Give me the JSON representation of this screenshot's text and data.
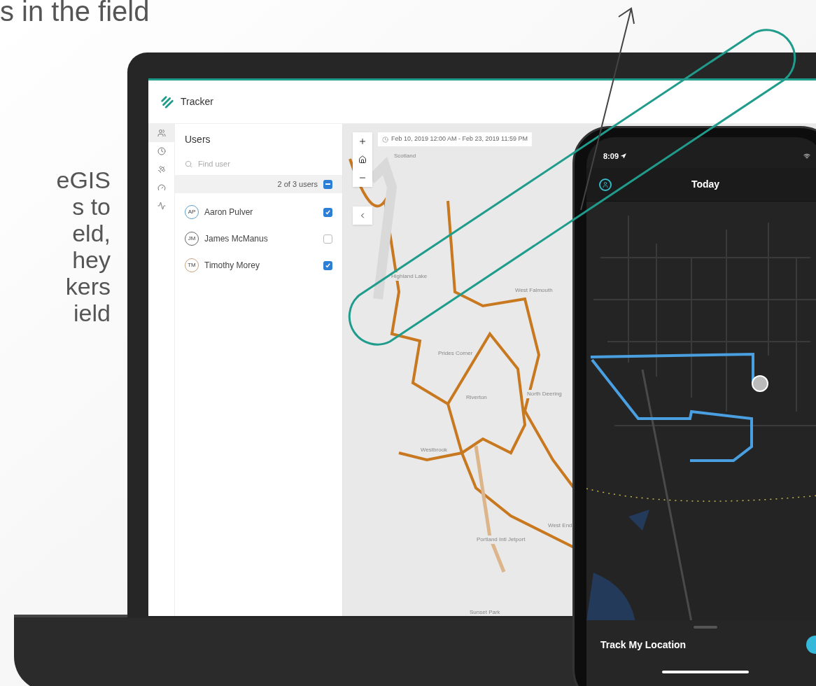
{
  "slide": {
    "heading": "s in the field",
    "body_lines": [
      "eGIS",
      "s to",
      "eld,",
      "hey",
      "kers",
      "ield"
    ]
  },
  "tracker": {
    "app_title": "Tracker",
    "rail": [
      {
        "kind": "users",
        "selected": true
      },
      {
        "kind": "time",
        "selected": false
      },
      {
        "kind": "satellite",
        "selected": false
      },
      {
        "kind": "gauge",
        "selected": false
      },
      {
        "kind": "pulse",
        "selected": false
      }
    ],
    "users_panel": {
      "title": "Users",
      "search": {
        "placeholder": "Find user"
      },
      "count": "2 of 3 users",
      "select_all_partial": true,
      "users": [
        {
          "initials": "AP",
          "name": "Aaron Pulver",
          "checked": true,
          "color": "#5a9ec9"
        },
        {
          "initials": "JM",
          "name": "James McManus",
          "checked": false,
          "color": "#666666"
        },
        {
          "initials": "TM",
          "name": "Timothy Morey",
          "checked": true,
          "color": "#c9a27a"
        }
      ]
    },
    "map": {
      "date_range": "Feb 10, 2019 12:00 AM - Feb 23, 2019 11:59 PM",
      "labels": [
        "Scotland",
        "Highland Lake",
        "West Falmouth",
        "Prides Corner",
        "Riverton",
        "North Deering",
        "Westbrook",
        "West End",
        "Portland Intl Jetport",
        "Sunset Park"
      ]
    }
  },
  "phone": {
    "time": "8:09",
    "title": "Today",
    "sheet": {
      "label": "Track My Location",
      "on": true
    }
  }
}
